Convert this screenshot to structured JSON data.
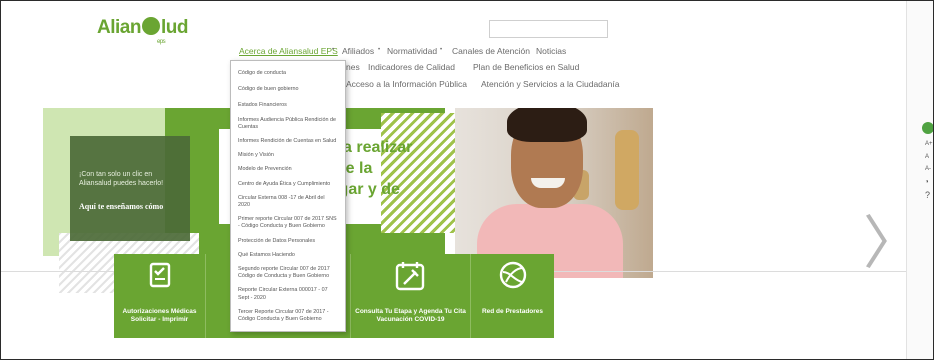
{
  "logo": {
    "text_left": "Alian",
    "text_right": "lud",
    "sub": "eps"
  },
  "search": {
    "value": "",
    "placeholder": ""
  },
  "nav": {
    "row1": [
      "Acerca de Aliansalud EPS",
      "•",
      "Afiliados",
      "•",
      "Normatividad",
      "•",
      "Canales de Atención",
      "Noticias"
    ],
    "row2": [
      "nes",
      "Indicadores de Calidad",
      "Plan de Beneficios en Salud"
    ],
    "row3": [
      "Acceso a la Información Pública",
      "Atención y Servicios a la Ciudadanía"
    ]
  },
  "dropdown": {
    "items": [
      "Código de conducta",
      "Código de buen gobierno",
      "Estados Financieros",
      "Informes Audiencia Pública Rendición de Cuentas",
      "Informes Rendición de Cuentas en Salud",
      "Misión y Visión",
      "Modelo de Prevención",
      "Centro de Ayuda Ética y Cumplimiento",
      "Circular Externa 008 -17 de Abril del 2020",
      "Primer reporte Circular 007 de 2017 SNS - Código Conducta y Buen Gobierno",
      "Protección de Datos Personales",
      "Qué Estamos Haciendo",
      "Segundo reporte Circular 007 de 2017 Código de Conducta y Buen Gobierno",
      "Reporte Circular Externa 000017 - 07 Sept - 2020",
      "Tercer Reporte Circular 007 de 2017 - Código Conducta y Buen Gobierno"
    ]
  },
  "hero": {
    "side_text": "¡Con tan solo un clic en Aliansalud puedes hacerlo!",
    "side_cta": "Aquí te enseñamos cómo",
    "headline": [
      "ler a realizar",
      "sde la",
      "hogar y de"
    ]
  },
  "tiles": [
    {
      "icon": "document-check-icon",
      "label": "Autorizaciones Médicas Solicitar - Imprimir"
    },
    {
      "icon": "document-check-icon",
      "label": ""
    },
    {
      "icon": "calendar-vaccine-icon",
      "label": "Consulta Tu Etapa y Agenda Tu Cita Vacunación COVID-19"
    },
    {
      "icon": "globe-network-icon",
      "label": "Red de Prestadores"
    }
  ],
  "side_tools": [
    "A+",
    "A",
    "A-",
    "◑",
    "?"
  ],
  "colors": {
    "brand_green": "#6aa532",
    "light_green": "#cfe6b2",
    "dark_green": "#4c6a37"
  }
}
